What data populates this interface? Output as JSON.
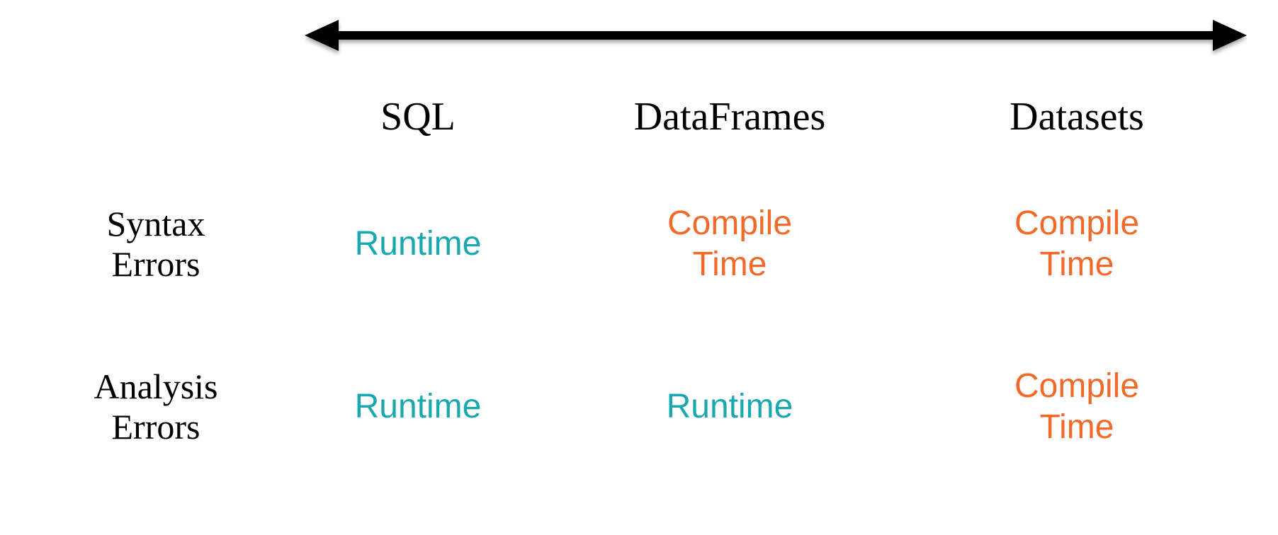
{
  "columns": {
    "sql": "SQL",
    "dataframes": "DataFrames",
    "datasets": "Datasets"
  },
  "rows": {
    "syntax": "Syntax\nErrors",
    "analysis": "Analysis\nErrors"
  },
  "cells": {
    "syntax_sql": {
      "text": "Runtime",
      "kind": "runtime"
    },
    "syntax_dataframes": {
      "text": "Compile\nTime",
      "kind": "compile"
    },
    "syntax_datasets": {
      "text": "Compile\nTime",
      "kind": "compile"
    },
    "analysis_sql": {
      "text": "Runtime",
      "kind": "runtime"
    },
    "analysis_dataframes": {
      "text": "Runtime",
      "kind": "runtime"
    },
    "analysis_datasets": {
      "text": "Compile\nTime",
      "kind": "compile"
    }
  },
  "colors": {
    "runtime": "#1aa8b0",
    "compile": "#f26a2a"
  }
}
